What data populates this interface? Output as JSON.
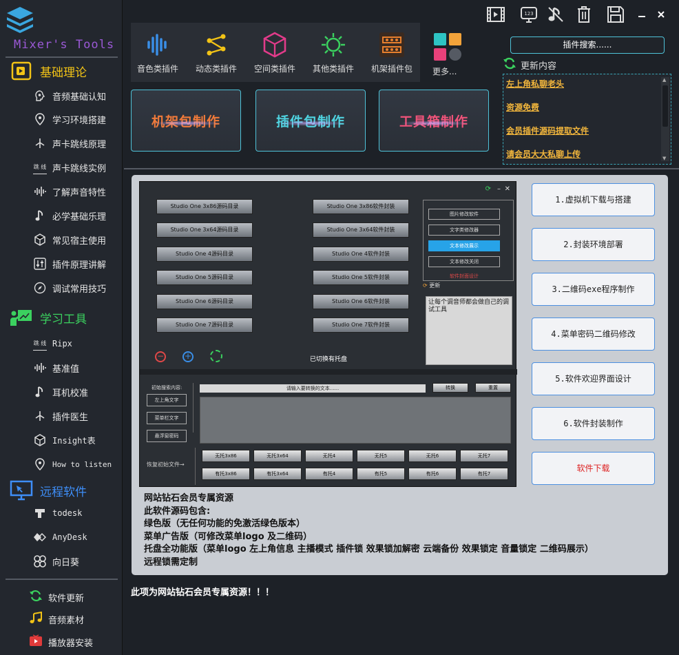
{
  "app": {
    "title": "Mixer's Tools"
  },
  "sidebar": {
    "sections": [
      {
        "label": "基础理论",
        "color": "#f2c316"
      },
      {
        "label": "学习工具",
        "color": "#3bd15f"
      },
      {
        "label": "远程软件",
        "color": "#3e8ef7"
      }
    ],
    "theory_items": [
      "音频基础认知",
      "学习环境搭建",
      "声卡跳线原理",
      "声卡跳线实例",
      "了解声音特性",
      "必学基础乐理",
      "常见宿主使用",
      "插件原理讲解",
      "调试常用技巧"
    ],
    "tool_items": [
      "Ripx",
      "基准值",
      "耳机校准",
      "插件医生",
      "Insight表",
      "How to listen"
    ],
    "remote_items": [
      "todesk",
      "AnyDesk",
      "向日葵"
    ],
    "jump_tag": "跳 线",
    "bottom_items": [
      "软件更新",
      "音频素材",
      "播放器安装"
    ]
  },
  "categories": [
    "音色类插件",
    "动态类插件",
    "空间类插件",
    "其他类插件",
    "机架插件包",
    "更多..."
  ],
  "search": {
    "placeholder": "插件搜索......"
  },
  "refresh_label": "更新内容",
  "news": [
    "左上角私聊老头",
    "资源免费",
    "会员插件源码提取文件",
    "请会员大大私聊上传"
  ],
  "big_buttons": [
    "机架包制作",
    "插件包制作",
    "工具箱制作"
  ],
  "inner": {
    "left_buttons": [
      "Studio One 3x86源码目录",
      "Studio One 3x64源码目录",
      "Studio One 4源码目录",
      "Studio One 5源码目录",
      "Studio One 6源码目录",
      "Studio One 7源码目录"
    ],
    "right_buttons": [
      "Studio One 3x86软件封装",
      "Studio One 3x64软件封装",
      "Studio One 4软件封装",
      "Studio One 5软件封装",
      "Studio One 6软件封装",
      "Studio One 7软件封装"
    ],
    "list_items": [
      "图片修改软件",
      "文字类修改器",
      "文本修改展示",
      "文本修改关闭",
      "软件封面设计"
    ],
    "refresh": "更新",
    "memo": "让每个调音师都会做自己的调试工具",
    "status": "已切换有托盘",
    "search_label": "初始搜索内容:",
    "left_small": [
      "左上角文字",
      "菜单栏文字",
      "悬浮窗密码"
    ],
    "input_placeholder": "请输入要转换的文本......",
    "convert": "转换",
    "reset": "重置",
    "restore": "恢复初始文件→",
    "no_tray": [
      "无托3x86",
      "无托3x64",
      "无托4",
      "无托5",
      "无托6",
      "无托7"
    ],
    "tray": [
      "有托3x86",
      "有托3x64",
      "有托4",
      "有托5",
      "有托6",
      "有托7"
    ]
  },
  "side_buttons": [
    "1.虚拟机下载与搭建",
    "2.封装环境部署",
    "3.二维码exe程序制作",
    "4.菜单密码二维码修改",
    "5.软件欢迎界面设计",
    "6.软件封装制作",
    "软件下载"
  ],
  "description": [
    "网站钻石会员专属资源",
    "此软件源码包含:",
    "绿色版（无任何功能的免激活绿色版本）",
    "菜单广告版（可修改菜单logo 及二维码）",
    "托盘全功能版（菜单logo 左上角信息 主播模式 插件锁 效果锁加解密  云端备份 效果锁定 音量锁定 二维码展示）",
    "远程锁需定制"
  ],
  "footer_note": "此项为网站钻石会员专属资源！！！"
}
